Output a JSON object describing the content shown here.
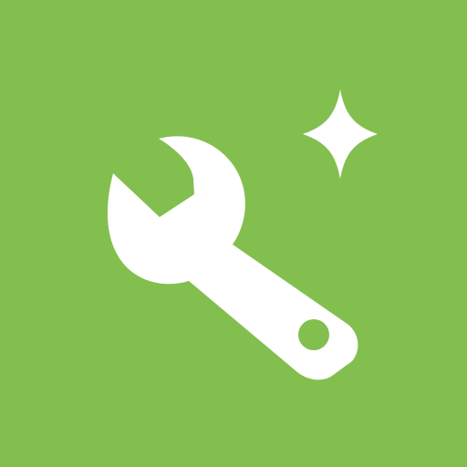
{
  "app_icon": {
    "background_color": "#83bf4f",
    "glyph_color": "#ffffff",
    "icons": [
      "wrench-icon",
      "sparkle-icon"
    ]
  }
}
